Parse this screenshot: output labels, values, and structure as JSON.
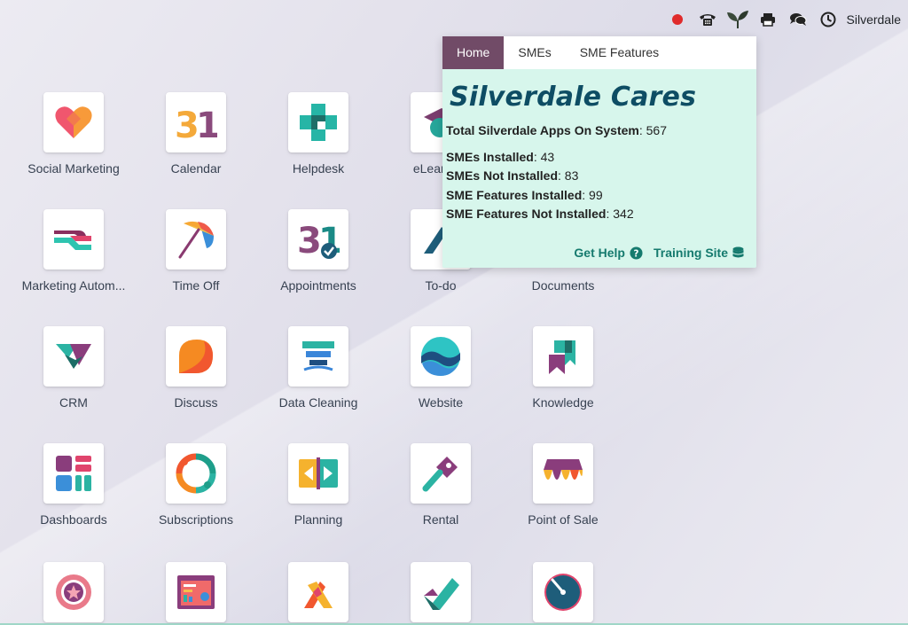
{
  "topbar": {
    "company": "Silverdale",
    "icons": [
      "status-dot-icon",
      "phone-icon",
      "leaf-icon",
      "print-icon",
      "chat-icon",
      "clock-icon"
    ],
    "status_color": "#e02b2b"
  },
  "apps": [
    {
      "label": "Social Marketing",
      "icon": "heart-icon"
    },
    {
      "label": "Calendar",
      "icon": "calendar-icon"
    },
    {
      "label": "Helpdesk",
      "icon": "helpdesk-icon"
    },
    {
      "label": "eLearning",
      "icon": "elearning-icon"
    },
    {
      "label": "Marketing Autom...",
      "icon": "marketing-automation-icon"
    },
    {
      "label": "Time Off",
      "icon": "umbrella-icon"
    },
    {
      "label": "Appointments",
      "icon": "appointments-icon"
    },
    {
      "label": "To-do",
      "icon": "todo-icon"
    },
    {
      "label": "Documents",
      "icon": "documents-icon"
    },
    {
      "label": "CRM",
      "icon": "crm-icon"
    },
    {
      "label": "Discuss",
      "icon": "discuss-icon"
    },
    {
      "label": "Data Cleaning",
      "icon": "data-cleaning-icon"
    },
    {
      "label": "Website",
      "icon": "website-icon"
    },
    {
      "label": "Knowledge",
      "icon": "knowledge-icon"
    },
    {
      "label": "Dashboards",
      "icon": "dashboards-icon"
    },
    {
      "label": "Subscriptions",
      "icon": "subscriptions-icon"
    },
    {
      "label": "Planning",
      "icon": "planning-icon"
    },
    {
      "label": "Rental",
      "icon": "rental-icon"
    },
    {
      "label": "Point of Sale",
      "icon": "point-of-sale-icon"
    }
  ],
  "popup": {
    "tabs": [
      {
        "label": "Home",
        "active": true
      },
      {
        "label": "SMEs",
        "active": false
      },
      {
        "label": "SME Features",
        "active": false
      }
    ],
    "title": "Silverdale Cares",
    "total": {
      "label": "Total Silverdale Apps On System",
      "value": ": 567"
    },
    "stats": [
      {
        "label": "SMEs Installed",
        "value": ": 43"
      },
      {
        "label": "SMEs Not Installed",
        "value": ": 83"
      },
      {
        "label": "SME Features Installed",
        "value": ": 99"
      },
      {
        "label": "SME Features Not Installed",
        "value": ": 342"
      }
    ],
    "links": {
      "help": "Get Help",
      "training": "Training Site"
    },
    "colors": {
      "background": "#d7f6ec",
      "active_tab": "#714b67",
      "title": "#0e4d64",
      "link": "#157a6e"
    }
  }
}
